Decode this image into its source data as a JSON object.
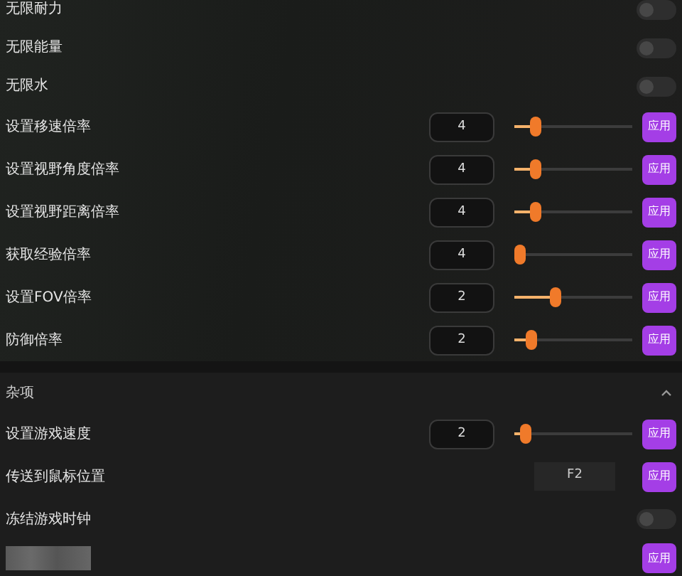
{
  "sections": [
    {
      "rows": [
        {
          "kind": "toggle",
          "label": "无限耐力",
          "on": false
        },
        {
          "kind": "toggle",
          "label": "无限能量",
          "on": false
        },
        {
          "kind": "toggle",
          "label": "无限水",
          "on": false
        },
        {
          "kind": "slider",
          "label": "设置移速倍率",
          "value": "4",
          "level": 0.15,
          "button": "应用"
        },
        {
          "kind": "slider",
          "label": "设置视野角度倍率",
          "value": "4",
          "level": 0.15,
          "button": "应用"
        },
        {
          "kind": "slider",
          "label": "设置视野距离倍率",
          "value": "4",
          "level": 0.15,
          "button": "应用"
        },
        {
          "kind": "slider",
          "label": "获取经验倍率",
          "value": "4",
          "level": 0,
          "button": "应用"
        },
        {
          "kind": "slider",
          "label": "设置FOV倍率",
          "value": "2",
          "level": 0.33,
          "button": "应用"
        },
        {
          "kind": "slider",
          "label": "防御倍率",
          "value": "2",
          "level": 0.1,
          "button": "应用"
        }
      ]
    },
    {
      "title": "杂项",
      "expanded": true,
      "rows": [
        {
          "kind": "slider",
          "label": "设置游戏速度",
          "value": "2",
          "level": 0.05,
          "button": "应用"
        },
        {
          "kind": "hotkey",
          "label": "传送到鼠标位置",
          "value": "F2",
          "button": "应用"
        },
        {
          "kind": "toggle",
          "label": "冻结游戏时钟",
          "on": false
        },
        {
          "kind": "redacted",
          "button": "应用"
        }
      ]
    }
  ]
}
